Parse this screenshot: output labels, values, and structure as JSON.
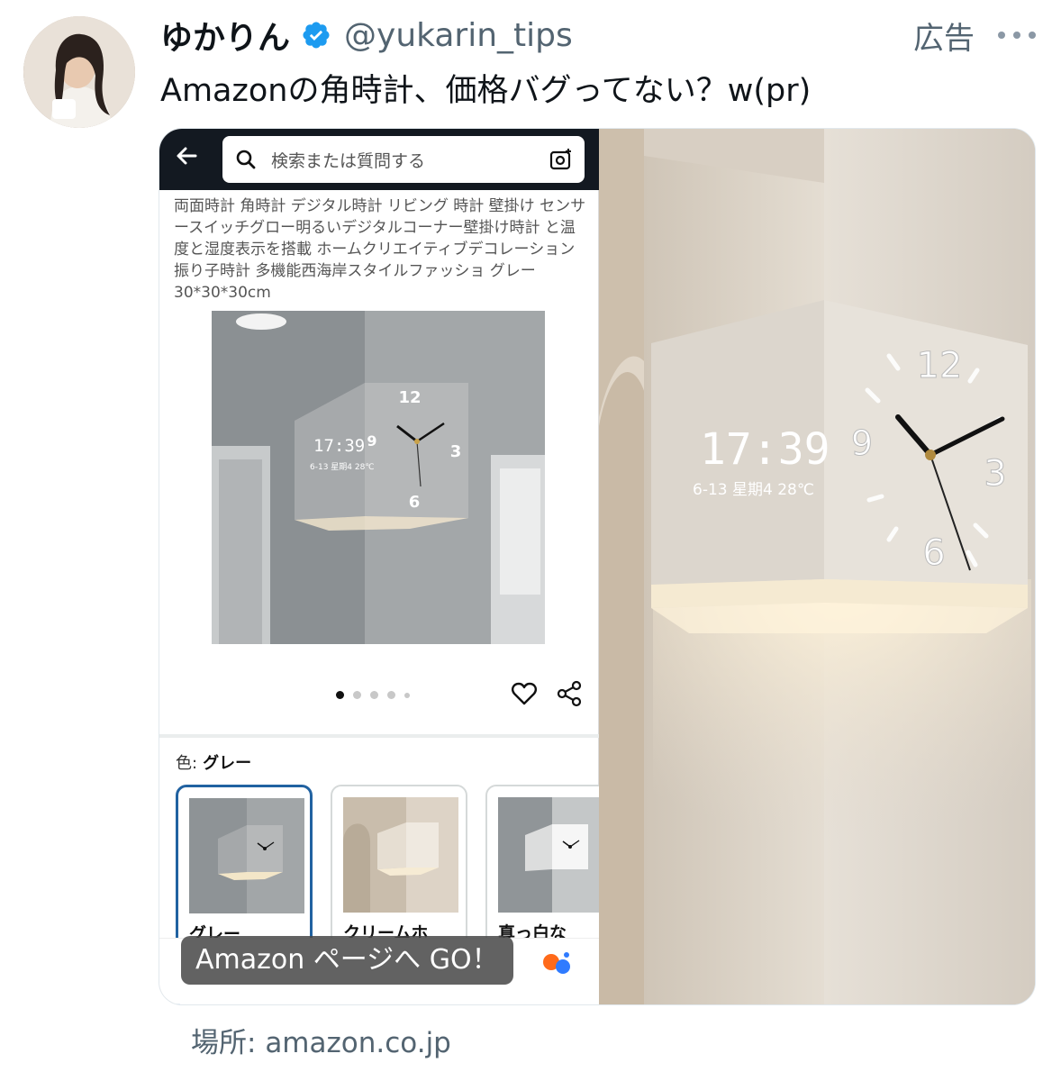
{
  "author": {
    "display_name": "ゆかりん",
    "handle": "@yukarin_tips",
    "verified_icon": "verified-badge-icon",
    "verified_color": "#1d9bf0"
  },
  "ad_label": "広告",
  "more_icon": "more-dots-icon",
  "tweet_text": "Amazonの角時計、価格バグってない？w(pr)",
  "media": {
    "phone": {
      "search_placeholder": "検索または質問する",
      "product_title": "両面時計 角時計 デジタル時計 リビング 時計 壁掛け センサースイッチグロー明るいデジタルコーナー壁掛け時計 と温度と湿度表示を搭載 ホームクリエイティブデコレーション振り子時計 多機能西海岸スタイルファッショ グレー 30*30*30cm",
      "product_clock": {
        "digital_time": "17:39",
        "digital_sub": "6-13 星期4 28℃",
        "numerals": [
          "12",
          "3",
          "6",
          "9"
        ]
      },
      "image_dots": 5,
      "active_dot": 1,
      "color_label": "色:",
      "color_value": "グレー",
      "variants": [
        {
          "label": "グレー",
          "selected": true
        },
        {
          "label": "クリームホ",
          "selected": false
        },
        {
          "label": "真っ白な",
          "selected": false
        }
      ],
      "amazon_header_color": "#131921",
      "selected_border_color": "#2162a1"
    },
    "photo_clock": {
      "digital_time": "17:39",
      "digital_sub": "6-13 星期4 28℃",
      "numerals": [
        "12",
        "3",
        "6",
        "9"
      ]
    },
    "cta_label": "Amazon ページへ GO！"
  },
  "link": {
    "prefix": "場所:",
    "domain": "amazon.co.jp"
  }
}
